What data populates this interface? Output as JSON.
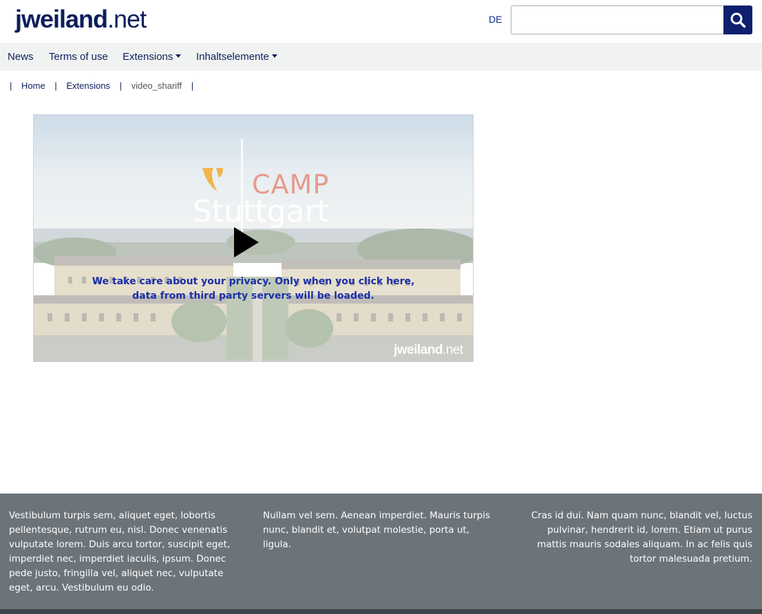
{
  "header": {
    "logo_main": "jweiland",
    "logo_tld": ".net",
    "lang_label": "DE",
    "search": {
      "placeholder": "",
      "value": ""
    },
    "search_icon": "search-icon",
    "brand_color": "#0d1f6e"
  },
  "nav": {
    "items": [
      {
        "label": "News",
        "dropdown": false
      },
      {
        "label": "Terms of use",
        "dropdown": false
      },
      {
        "label": "Extensions",
        "dropdown": true
      },
      {
        "label": "Inhaltselemente",
        "dropdown": true
      }
    ]
  },
  "breadcrumb": {
    "items": [
      {
        "label": "Home",
        "link": true
      },
      {
        "label": "Extensions",
        "link": true
      },
      {
        "label": "video_shariff",
        "link": false
      }
    ]
  },
  "video": {
    "camp_text": "CAMP",
    "stuttgart_text": "Stuttgart",
    "privacy_line1": "We take care about your privacy. Only when you click here,",
    "privacy_line2": "data from third party servers will be loaded.",
    "watermark_main": "jweiland",
    "watermark_tld": ".net",
    "play_icon": "play-icon"
  },
  "footer": {
    "col1": "Vestibulum turpis sem, aliquet eget, lobortis pellentesque, rutrum eu, nisl. Donec venenatis vulputate lorem. Duis arcu tortor, suscipit eget, imperdiet nec, imperdiet iaculis, ipsum. Donec pede justo, fringilla vel, aliquet nec, vulputate eget, arcu. Vestibulum eu odio.",
    "col2": "Nullam vel sem. Aenean imperdiet. Mauris turpis nunc, blandit et, volutpat molestie, porta ut, ligula.",
    "col3": "Cras id dui. Nam quam nunc, blandit vel, luctus pulvinar, hendrerit id, lorem. Etiam ut purus mattis mauris sodales aliquam. In ac felis quis tortor malesuada pretium."
  }
}
